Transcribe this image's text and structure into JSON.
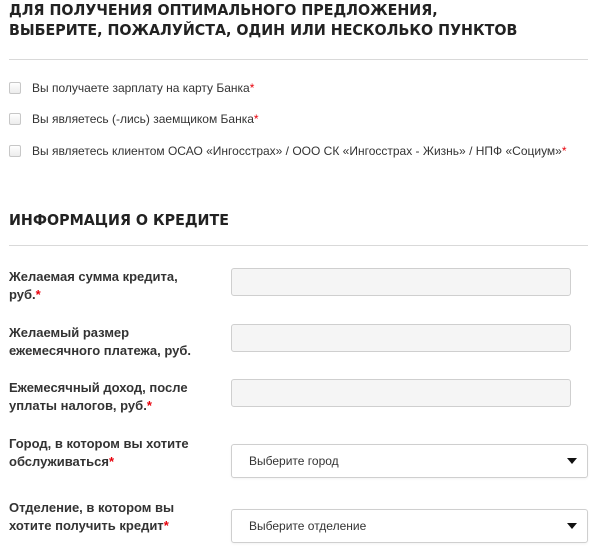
{
  "offers_section": {
    "title_line1": "ДЛЯ ПОЛУЧЕНИЯ ОПТИМАЛЬНОГО ПРЕДЛОЖЕНИЯ,",
    "title_line2": "ВЫБЕРИТЕ, ПОЖАЛУЙСТА, ОДИН ИЛИ НЕСКОЛЬКО ПУНКТОВ",
    "options": [
      {
        "label": "Вы получаете зарплату на карту Банка",
        "required_mark": "*",
        "checked": false
      },
      {
        "label": "Вы являетесь (-лись) заемщиком Банка",
        "required_mark": "*",
        "checked": false
      },
      {
        "label": "Вы являетесь клиентом ОСАО «Ингосстрах» / ООО СК «Ингосстрах - Жизнь» / НПФ «Социум»",
        "required_mark": "*",
        "checked": false
      }
    ]
  },
  "credit_section": {
    "title": "ИНФОРМАЦИЯ О КРЕДИТЕ",
    "fields": [
      {
        "label_line1": "Желаемая сумма кредита,",
        "label_line2": "руб.",
        "required_mark": "*",
        "value": ""
      },
      {
        "label_line1": "Желаемый размер",
        "label_line2": "ежемесячного платежа, руб.",
        "required_mark": "",
        "value": ""
      },
      {
        "label_line1": "Ежемесячный доход, после",
        "label_line2": "уплаты налогов, руб.",
        "required_mark": "*",
        "value": ""
      },
      {
        "label_line1": "Город, в котором вы хотите",
        "label_line2": "обслуживаться",
        "required_mark": "*",
        "value": "Выберите город"
      },
      {
        "label_line1": "Отделение, в котором вы",
        "label_line2": "хотите получить кредит",
        "required_mark": "*",
        "value": "Выберите отделение"
      }
    ]
  },
  "colors": {
    "required_mark": "#e8000b",
    "divider": "#d9d9d9",
    "input_background": "#f5f5f5",
    "text": "#333333"
  }
}
